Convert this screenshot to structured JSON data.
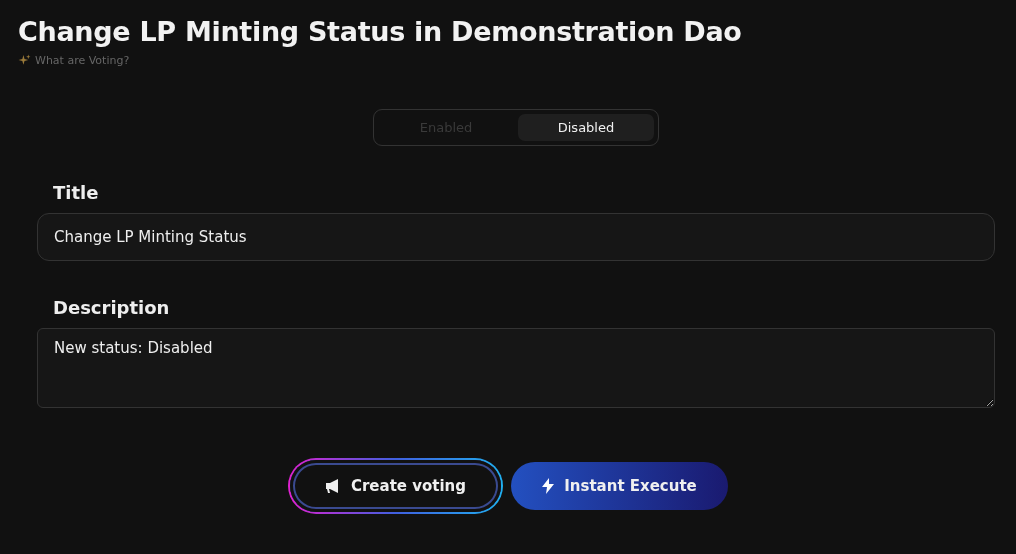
{
  "page": {
    "title": "Change LP Minting Status in Demonstration Dao",
    "help_link": "What are Voting?"
  },
  "status_toggle": [
    {
      "label": "Enabled",
      "selected": false
    },
    {
      "label": "Disabled",
      "selected": true
    }
  ],
  "fields": [
    {
      "kind": "input",
      "label": "Title",
      "value": "Change LP Minting Status"
    },
    {
      "kind": "textarea",
      "label": "Description",
      "value": "New status: Disabled"
    }
  ],
  "buttons": [
    {
      "kind": "outline",
      "label": "Create voting"
    },
    {
      "kind": "filled",
      "label": "Instant Execute"
    }
  ]
}
